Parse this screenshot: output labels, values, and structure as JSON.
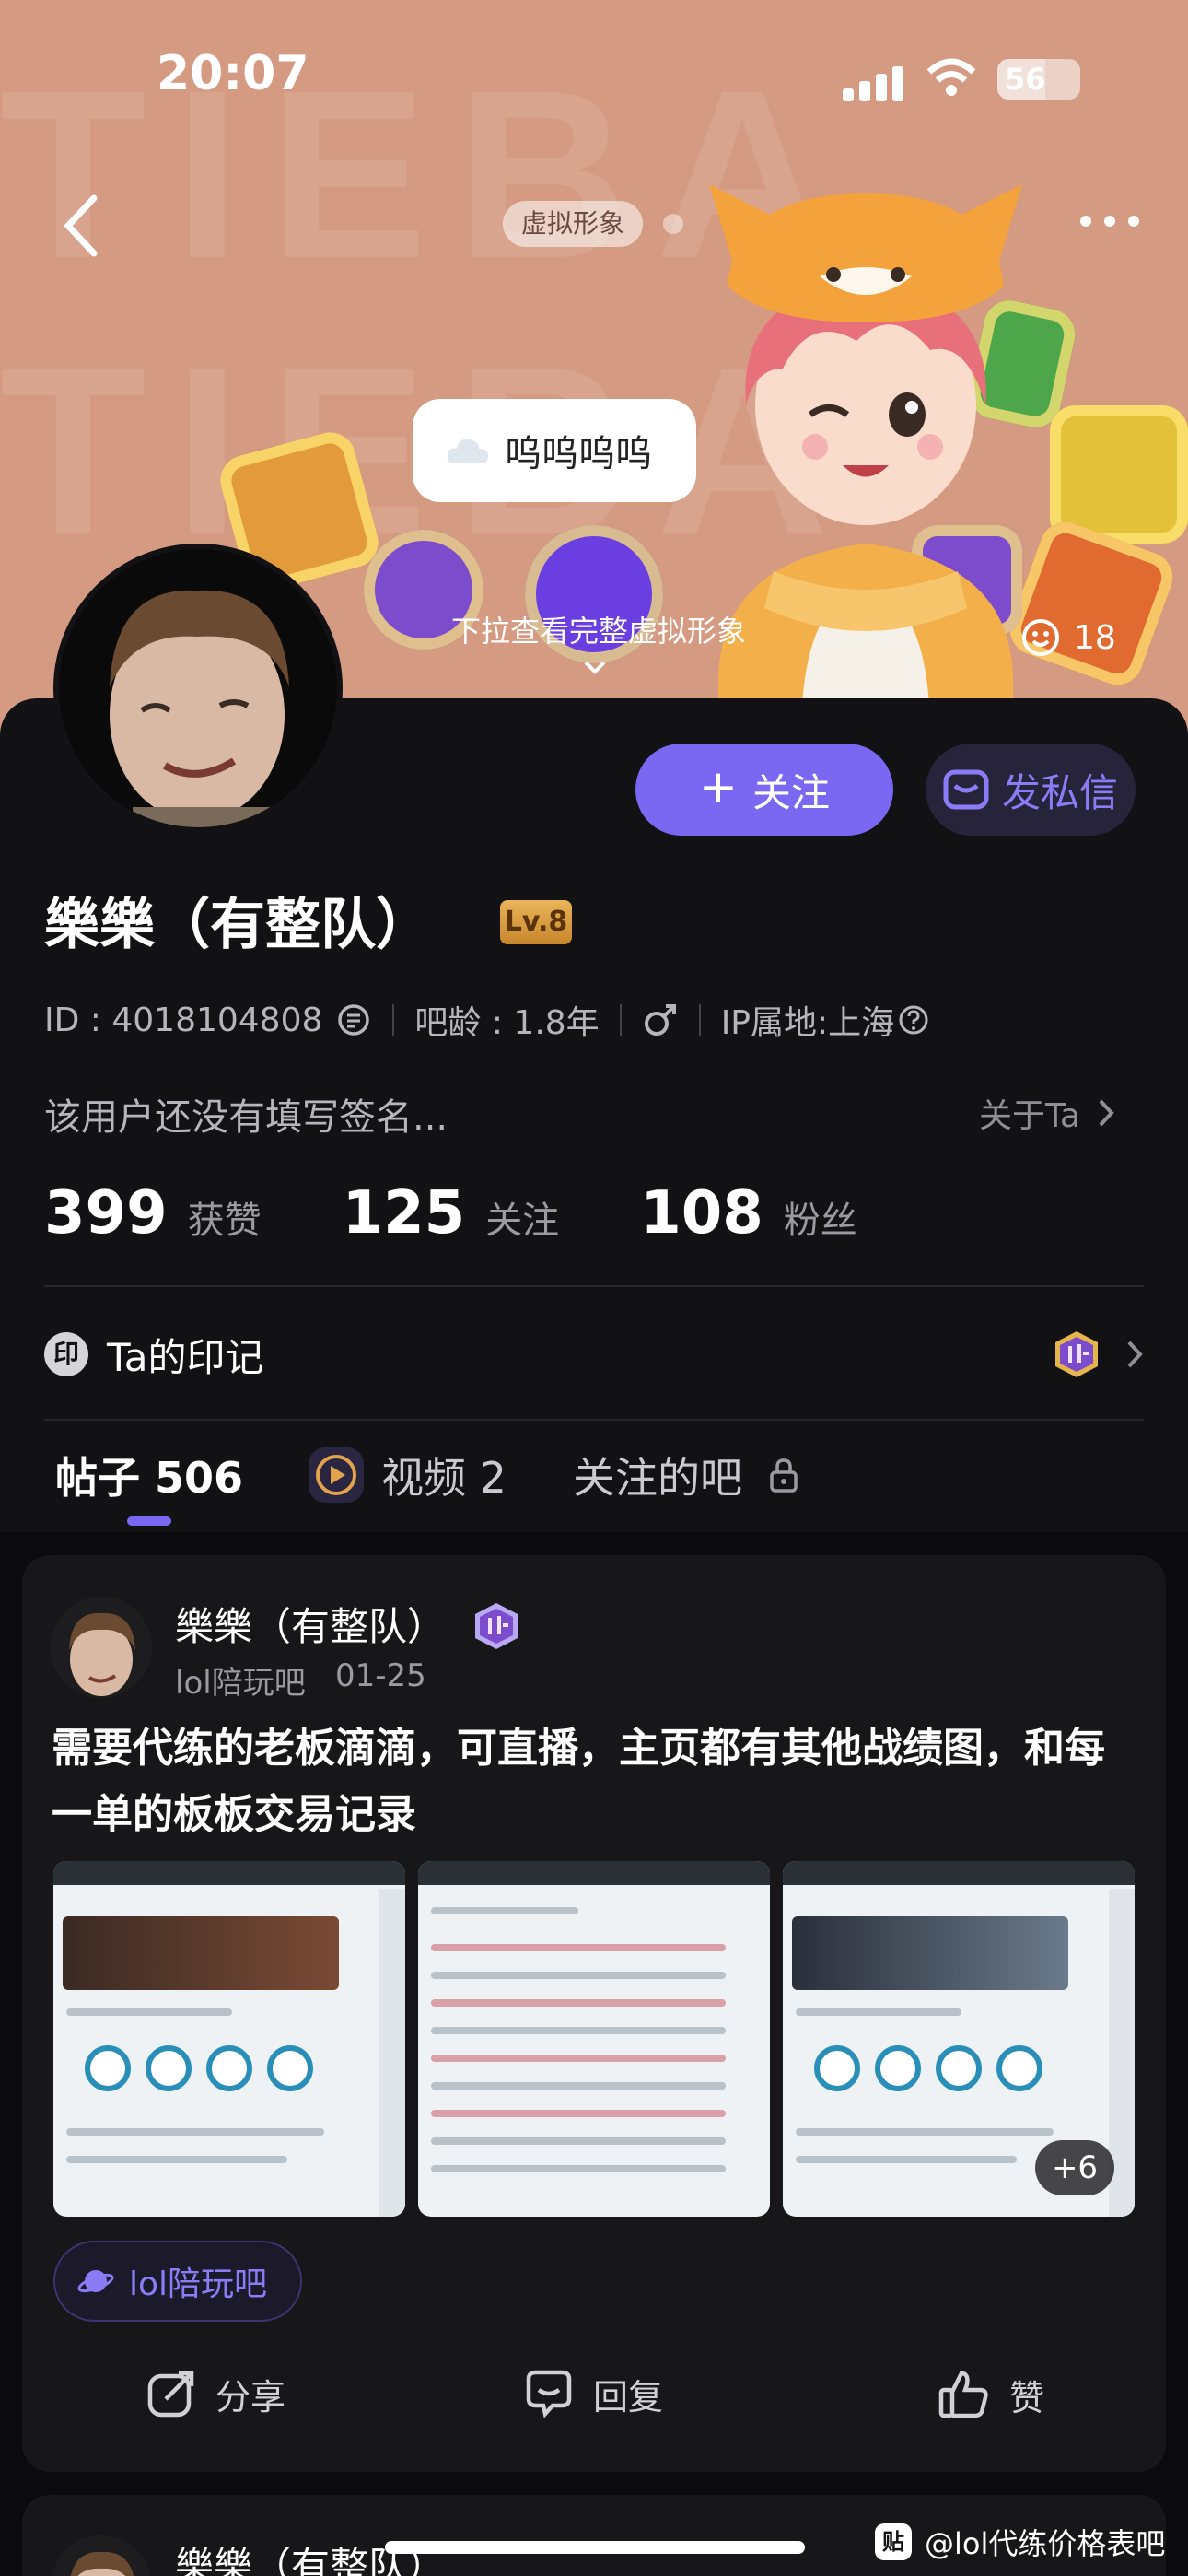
{
  "status_bar": {
    "time": "20:07",
    "battery": "56"
  },
  "header": {
    "avatar_tag": "虚拟形象",
    "speech_bubble": "呜呜呜呜",
    "pull_hint": "下拉查看完整虚拟形象",
    "avatar_likes": "18"
  },
  "profile": {
    "follow_label": "关注",
    "follow_plus": "+",
    "message_label": "发私信",
    "nickname": "樂樂（有整队）",
    "level": "Lv.8",
    "id_text": "ID : 4018104808",
    "bar_age": "吧龄 : 1.8年",
    "ip_location": "IP属地:上海",
    "signature": "该用户还没有填写签名...",
    "about_label": "关于Ta",
    "stats": [
      {
        "value": "399",
        "label": "获赞"
      },
      {
        "value": "125",
        "label": "关注"
      },
      {
        "value": "108",
        "label": "粉丝"
      }
    ],
    "imprint_icon": "印",
    "imprint_label": "Ta的印记"
  },
  "tabs": [
    {
      "label": "帖子 506"
    },
    {
      "label": "视频 2"
    },
    {
      "label": "关注的吧"
    }
  ],
  "post": {
    "author": "樂樂（有整队）",
    "forum": "lol陪玩吧",
    "date": "01-25",
    "title": "需要代练的老板滴滴，可直播，主页都有其他战绩图，和每一单的板板交易记录",
    "more_images": "+6",
    "forum_chip": "lol陪玩吧",
    "share_label": "分享",
    "reply_label": "回复",
    "like_label": "赞"
  },
  "post2": {
    "author": "樂樂（有整队）"
  },
  "watermark": {
    "icon": "贴",
    "text": "@lol代练价格表吧"
  },
  "colors": {
    "accent": "#7b68f2",
    "banner": "#d49a82",
    "card": "#17171a"
  }
}
